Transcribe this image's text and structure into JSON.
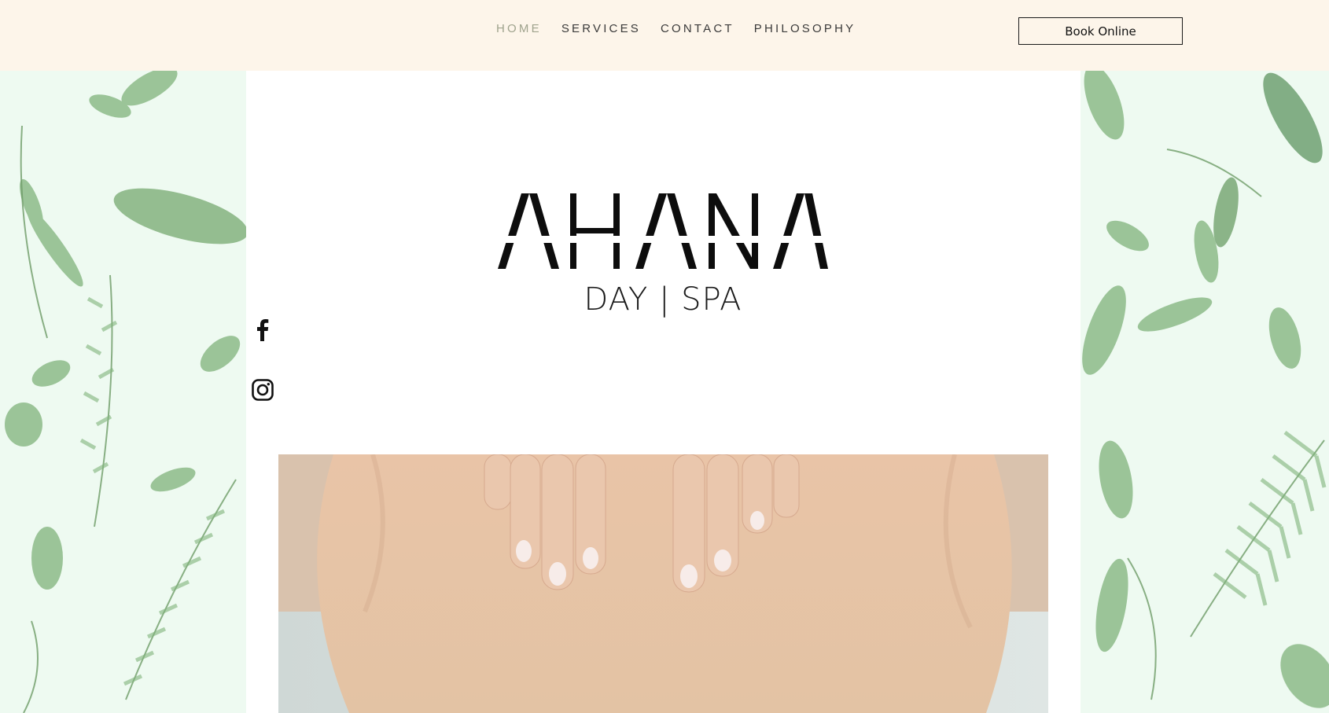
{
  "nav": {
    "items": [
      {
        "label": "HOME",
        "active": true
      },
      {
        "label": "SERVICES",
        "active": false
      },
      {
        "label": "CONTACT",
        "active": false
      },
      {
        "label": "PHILOSOPHY",
        "active": false
      }
    ]
  },
  "header": {
    "book_button_label": "Book Online"
  },
  "logo": {
    "wordmark": "AHANA",
    "tagline": "DAY | SPA"
  },
  "social": [
    {
      "name": "Facebook",
      "icon": "facebook-icon"
    },
    {
      "name": "Instagram",
      "icon": "instagram-icon"
    }
  ],
  "colors": {
    "topbar_bg": "#fdf5ea",
    "nav_active": "#9fa38d",
    "nav_text": "#3a3a3a",
    "side_panel_bg": "#eefaf1",
    "leaf_green": "#7fb27a"
  }
}
